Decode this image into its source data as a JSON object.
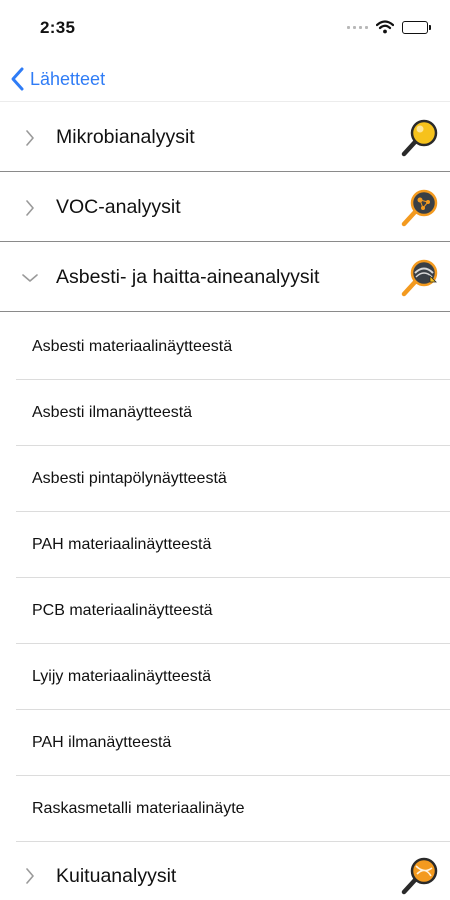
{
  "status_bar": {
    "time": "2:35"
  },
  "nav": {
    "back_label": "Lähetteet"
  },
  "sections": [
    {
      "label": "Mikrobianalyysit",
      "icon": "magnifier-microbe-icon",
      "expanded": false
    },
    {
      "label": "VOC-analyysit",
      "icon": "magnifier-voc-icon",
      "expanded": false
    },
    {
      "label": "Asbesti- ja haitta-aineanalyysit",
      "icon": "magnifier-asbestos-icon",
      "expanded": true
    },
    {
      "label": "Kuituanalyysit",
      "icon": "magnifier-fiber-icon",
      "expanded": false
    }
  ],
  "sub_items": [
    "Asbesti materiaalinäytteestä",
    "Asbesti ilmanäytteestä",
    "Asbesti pintapölynäytteestä",
    "PAH materiaalinäytteestä",
    "PCB materiaalinäytteestä",
    "Lyijy materiaalinäytteestä",
    "PAH ilmanäytteestä",
    "Raskasmetalli materiaalinäyte"
  ],
  "colors": {
    "accent": "#2f7cf6",
    "icon_orange": "#f39a1f",
    "icon_yellow": "#f6c21c"
  }
}
